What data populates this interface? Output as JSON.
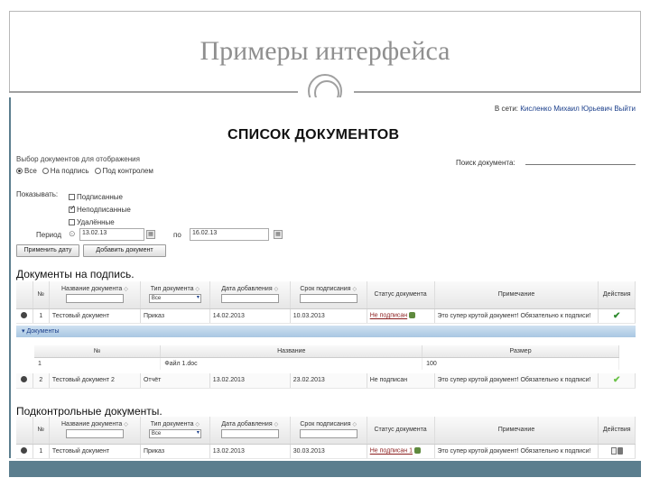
{
  "slide": {
    "title": "Примеры интерфейса"
  },
  "header": {
    "user_prefix": "В сети:",
    "user_name": "Кисленко Михаил Юрьевич",
    "logout": "Выйти"
  },
  "page_title": "СПИСОК ДОКУМЕНТОВ",
  "filter": {
    "choose_label": "Выбор документов для отображения",
    "radios": [
      "Все",
      "На подпись",
      "Под контролем"
    ],
    "selected_radio": 0,
    "search_label": "Поиск документа:",
    "search_value": "",
    "show_label": "Показывать:",
    "checks": [
      {
        "label": "Подписанные",
        "checked": false
      },
      {
        "label": "Неподписанные",
        "checked": true
      },
      {
        "label": "Удалённые",
        "checked": false
      }
    ],
    "period_label": "Период",
    "period_clear": "⊙",
    "date_from": "13.02.13",
    "to_label": "по",
    "date_to": "16.02.13",
    "apply_button": "Применить дату",
    "add_button": "Добавить документ"
  },
  "sections": {
    "to_sign": "Документы на подпись.",
    "controlled": "Подконтрольные документы."
  },
  "columns": {
    "num": "№",
    "doc_name": "Название документа",
    "doc_type": "Тип документа",
    "date_added": "Дата добавления",
    "sign_deadline": "Срок подписания",
    "status": "Статус документа",
    "note": "Примечание",
    "actions": "Действия",
    "type_filter_all": "Все",
    "sort_mark": "◇"
  },
  "table1": {
    "rows": [
      {
        "num": "1",
        "name": "Тестовый документ",
        "type": "Приказ",
        "added": "14.02.2013",
        "deadline": "10.03.2013",
        "status": "Не подписан",
        "note": "Это супер крутой документ! Обязательно к подписи!"
      },
      {
        "num": "2",
        "name": "Тестовый документ 2",
        "type": "Отчёт",
        "added": "13.02.2013",
        "deadline": "23.02.2013",
        "status": "Не подписан",
        "note": "Это супер крутой документ! Обязательно к подписи!"
      }
    ]
  },
  "subtable": {
    "bar_label": "▾ Документы",
    "headers": [
      "№",
      "Название",
      "Размер"
    ],
    "rows": [
      {
        "num": "1",
        "name": "Файл 1.doc",
        "size": "100"
      }
    ]
  },
  "table2": {
    "rows": [
      {
        "num": "1",
        "name": "Тестовый документ",
        "type": "Приказ",
        "added": "13.02.2013",
        "deadline": "30.03.2013",
        "status": "Не подписан 1",
        "note": "Это супер крутой документ! Обязательно к подписи!"
      }
    ]
  }
}
